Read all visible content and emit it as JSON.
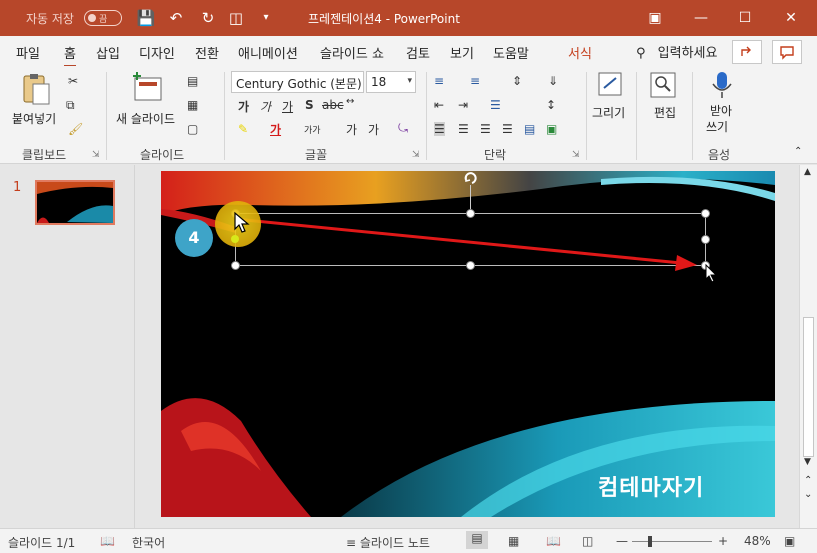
{
  "title_bar": {
    "autosave_label": "자동 저장",
    "autosave_state": "끔",
    "document_title": "프레젠테이션4  -  PowerPoint"
  },
  "menu": {
    "tabs": [
      "파일",
      "홈",
      "삽입",
      "디자인",
      "전환",
      "애니메이션",
      "슬라이드 쇼",
      "검토",
      "보기",
      "도움말",
      "서식"
    ],
    "active_tab": "홈",
    "search_label": "입력하세요"
  },
  "ribbon": {
    "clipboard": {
      "paste_label": "붙여넣기",
      "group_label": "클립보드"
    },
    "slides": {
      "new_slide_label": "새 슬라이드",
      "group_label": "슬라이드"
    },
    "font": {
      "font_name": "Century Gothic (본문)",
      "font_size": "18",
      "group_label": "글꼴"
    },
    "paragraph": {
      "group_label": "단락"
    },
    "drawing": {
      "draw_label": "그리기"
    },
    "editing": {
      "edit_label": "편집"
    },
    "voice": {
      "dictate_line1": "받아",
      "dictate_line2": "쓰기",
      "group_label": "음성"
    }
  },
  "thumbnail_pane": {
    "slide_number": "1"
  },
  "callout": {
    "step_number": "4"
  },
  "watermark": "컴테마자기",
  "status_bar": {
    "slide_info": "슬라이드 1/1",
    "language": "한국어",
    "notes_label": "슬라이드 노트",
    "zoom_level": "48%"
  },
  "colors": {
    "accent": "#b7472a",
    "arrow": "#e01818",
    "badge": "#3ea4c8"
  }
}
